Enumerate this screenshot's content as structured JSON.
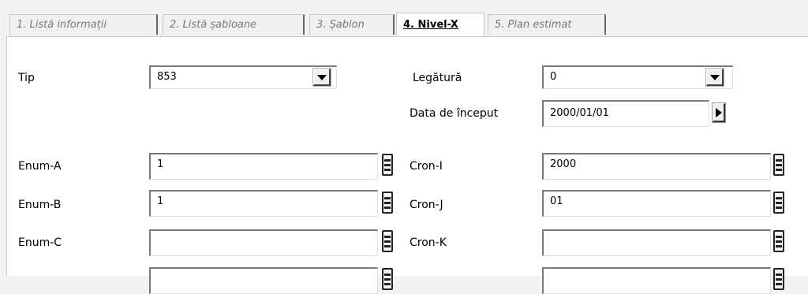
{
  "tabs": [
    {
      "label": "1. Listă informații",
      "active": false
    },
    {
      "label": "2. Listă șabloane",
      "active": false
    },
    {
      "label": "3. Șablon",
      "active": false
    },
    {
      "label": "4. Nivel-X",
      "active": true
    },
    {
      "label": "5. Plan estimat",
      "active": false
    }
  ],
  "form": {
    "tip": {
      "label": "Tip",
      "value": "853"
    },
    "legatura": {
      "label": "Legătură",
      "value": "0"
    },
    "data_inceput": {
      "label": "Data de început",
      "value": "2000/01/01"
    },
    "enum_a": {
      "label": "Enum-A",
      "value": "1"
    },
    "enum_b": {
      "label": "Enum-B",
      "value": "1"
    },
    "enum_c": {
      "label": "Enum-C",
      "value": ""
    },
    "enum_d": {
      "value": ""
    },
    "cron_i": {
      "label": "Cron-I",
      "value": "2000"
    },
    "cron_j": {
      "label": "Cron-J",
      "value": "01"
    },
    "cron_k": {
      "label": "Cron-K",
      "value": ""
    },
    "cron_l": {
      "value": ""
    }
  },
  "icons": {
    "dropdown": "chevron-down-icon",
    "next": "play-arrow-icon",
    "list_picker": "list-picker-icon"
  }
}
